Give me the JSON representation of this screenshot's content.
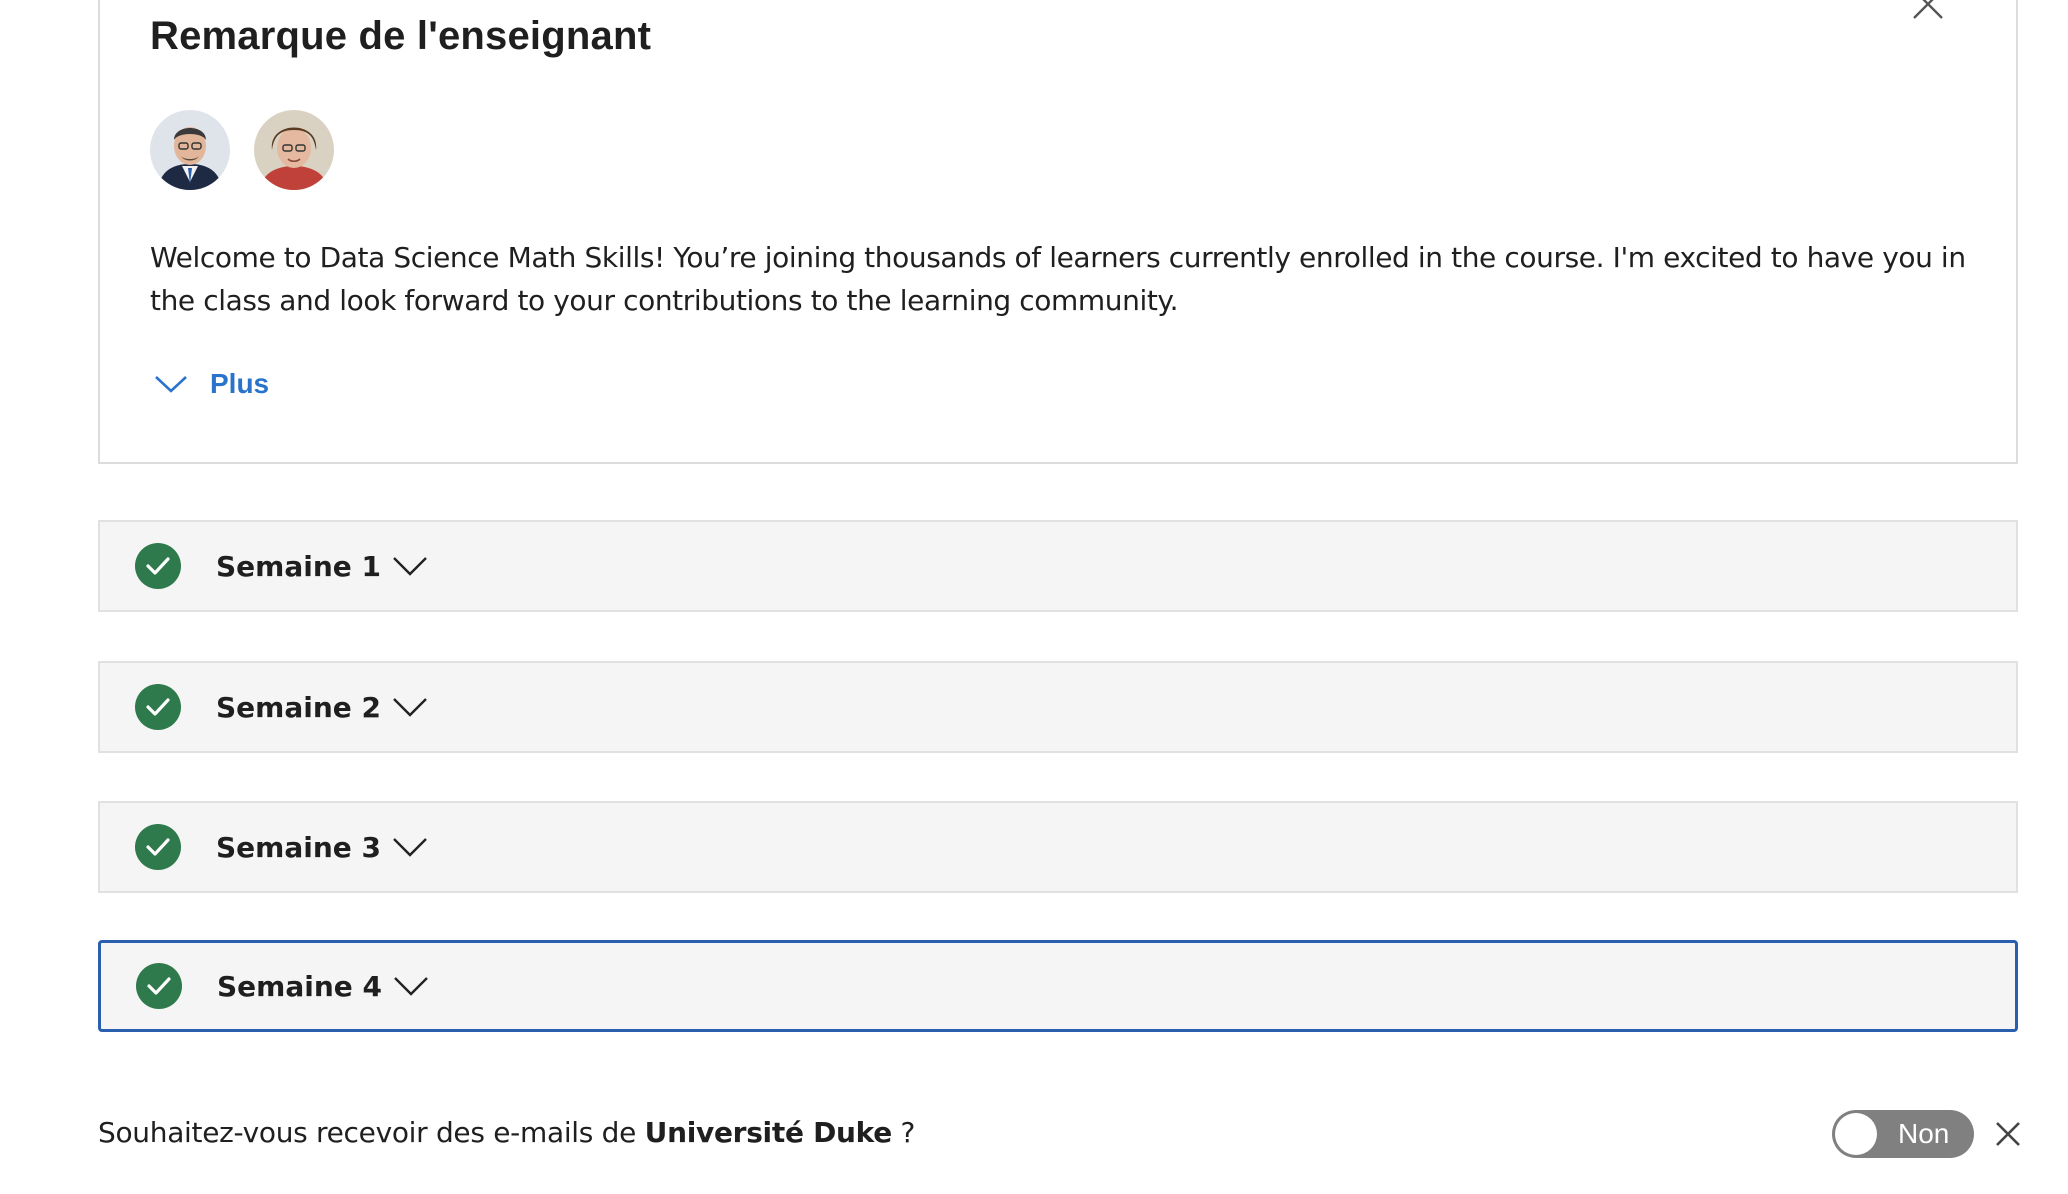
{
  "instructor_note": {
    "title": "Remarque de l'enseignant",
    "body": "Welcome to Data Science Math Skills! You’re joining thousands of learners currently enrolled in the course. I'm excited to have you in the class and look forward to your contributions to the learning community.",
    "more_label": "Plus",
    "icons": {
      "close": "close-icon",
      "expand": "chevron-down-icon"
    },
    "avatars": [
      {
        "icon": "avatar-instructor-1"
      },
      {
        "icon": "avatar-instructor-2"
      }
    ]
  },
  "weeks": [
    {
      "label": "Semaine 1",
      "status": "completed",
      "focused": false
    },
    {
      "label": "Semaine 2",
      "status": "completed",
      "focused": false
    },
    {
      "label": "Semaine 3",
      "status": "completed",
      "focused": false
    },
    {
      "label": "Semaine 4",
      "status": "completed",
      "focused": true
    }
  ],
  "email_prompt": {
    "text_before": "Souhaitez-vous recevoir des e-mails de ",
    "institution": "Université Duke",
    "text_after": " ?",
    "toggle_label": "Non",
    "toggle_on": false
  },
  "colors": {
    "accent": "#2a73cc",
    "check": "#2f7a4c",
    "focus": "#2a5fb0",
    "row_bg": "#f5f5f5",
    "toggle_off": "#808080"
  }
}
